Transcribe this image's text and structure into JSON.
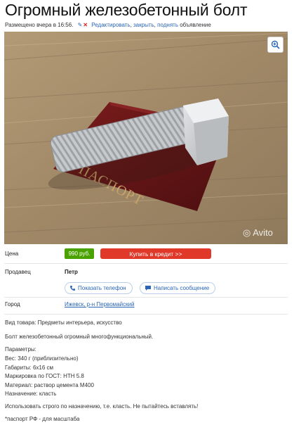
{
  "listing": {
    "title": "Огромный железобетонный болт",
    "posted": "Размещено вчера в 16:56.",
    "actions": {
      "edit": "Редактировать",
      "close": "закрыть",
      "raise": "поднять",
      "suffix": "объявление"
    }
  },
  "photo": {
    "watermark": "Avito",
    "icons": [
      "zoom-in-icon"
    ]
  },
  "price": {
    "label": "Цена",
    "value": "990 руб.",
    "credit_button": "Купить в кредит >>"
  },
  "seller": {
    "label": "Продавец",
    "name": "Петр",
    "show_phone": "Показать телефон",
    "write_message": "Написать сообщение"
  },
  "city": {
    "label": "Город",
    "value": "Ижевск, р-н Первомайский"
  },
  "description": {
    "category": "Вид товара: Предметы интерьера, искусство",
    "summary": "Болт железобетонный огромный многофункциональный.",
    "params_title": "Параметры:",
    "weight": "Вес: 340 г (приблизительно)",
    "size": "Габариты: 6x16 см",
    "gost": "Маркировка по ГОСТ: НТН 5.8",
    "material": "Материал: раствор цемента М400",
    "purpose": "Назначение: класть",
    "usage": "Использовать строго по назначению, т.е. класть. Не пытайтесь вставлять!",
    "footnote": "*паспорт РФ - для масштаба"
  },
  "colors": {
    "link": "#2a66b5",
    "price_badge": "#49a200",
    "credit_button": "#e0392a"
  }
}
